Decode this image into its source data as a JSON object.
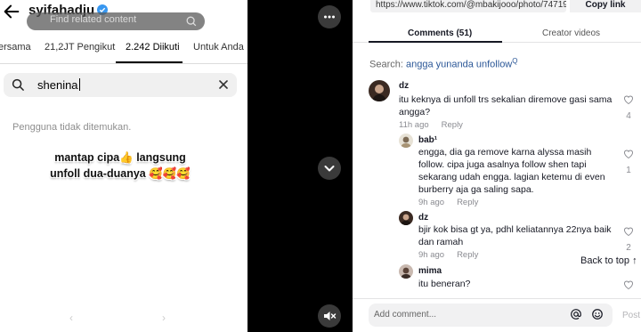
{
  "instagram": {
    "username": "syifahadju",
    "overlay_text": "Find related content",
    "tabs": [
      {
        "label": "ersama"
      },
      {
        "label": "21,2JT Pengikut"
      },
      {
        "label": "2.242 Diikuti"
      },
      {
        "label": "Untuk Anda"
      }
    ],
    "search_value": "shenina",
    "empty_message": "Pengguna tidak ditemukan.",
    "caption_line1": "mantap cipa👍 langsung",
    "caption_line2": "unfoll dua-duanya 🥰🥰🥰"
  },
  "tiktok": {
    "url": "https://www.tiktok.com/@mbakijooo/photo/74719801...",
    "copy_link_label": "Copy link",
    "tabs": {
      "comments": "Comments (51)",
      "creator_videos": "Creator videos"
    },
    "search_prefix": "Search:",
    "search_term": "angga yunanda unfollow",
    "search_icon": "Q",
    "comments": [
      {
        "name": "dz",
        "text": "itu keknya di unfoll trs sekalian diremove gasi sama angga?",
        "time": "11h ago",
        "reply": "Reply",
        "likes": "4"
      },
      {
        "name": "bab¹",
        "text": "engga, dia ga remove karna alyssa masih follow. cipa juga asalnya follow shen tapi sekarang udah engga. lagian ketemu di even burberry aja ga saling sapa.",
        "time": "9h ago",
        "reply": "Reply",
        "likes": "1"
      },
      {
        "name": "dz",
        "text": "bjir kok bisa gt ya, pdhl keliatannya 22nya baik dan ramah",
        "time": "9h ago",
        "reply": "Reply",
        "likes": "2"
      },
      {
        "name": "mima",
        "text": "itu beneran?",
        "time": "",
        "reply": "",
        "likes": ""
      }
    ],
    "back_to_top": "Back to top ↑",
    "comment_placeholder": "Add comment...",
    "post_label": "Post"
  },
  "colors": {
    "link_blue": "#2b5797",
    "muted": "#8a8b91",
    "verified_blue": "#3897f0"
  }
}
